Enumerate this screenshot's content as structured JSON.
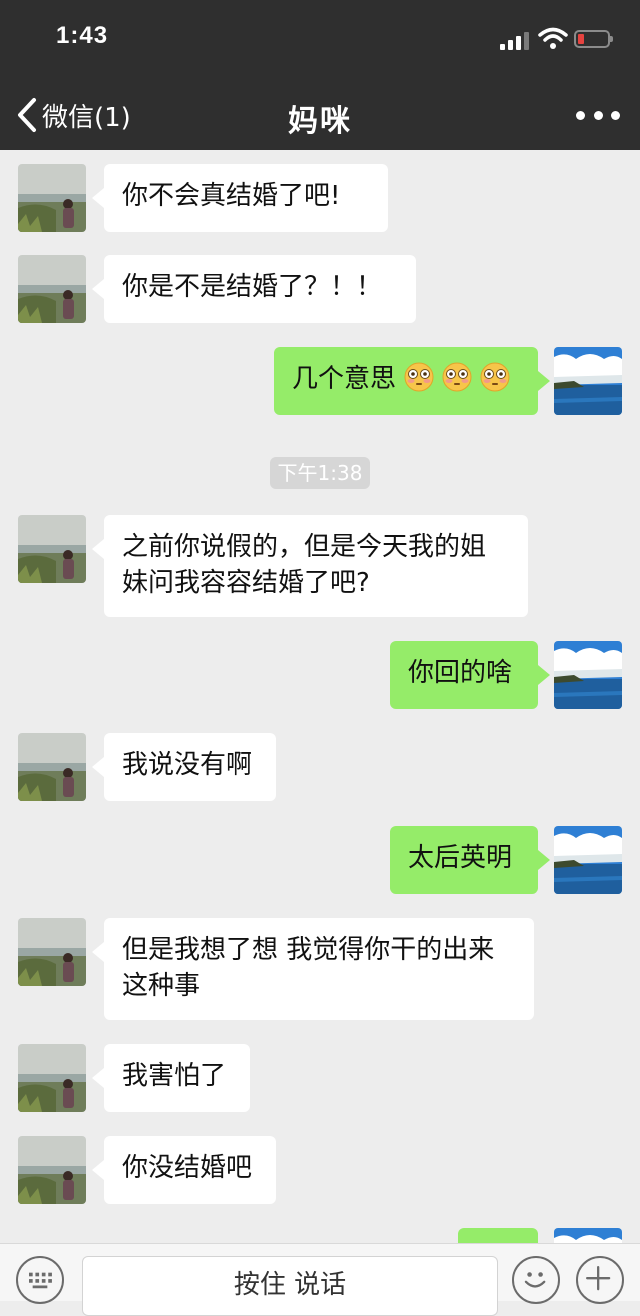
{
  "status_bar": {
    "time": "1:43"
  },
  "nav": {
    "back_label": "微信(1)",
    "title": "妈咪"
  },
  "colors": {
    "header_bg": "#2f2f2f",
    "chat_bg": "#ededed",
    "bubble_in": "#ffffff",
    "bubble_out": "#95ec69",
    "battery_low": "#e64340"
  },
  "messages": [
    {
      "from": "mom",
      "text": "你不会真结婚了吧!"
    },
    {
      "from": "mom",
      "text": "你是不是结婚了？！！"
    },
    {
      "from": "me",
      "text": "几个意思",
      "emoji": [
        "flushed-face-icon",
        "flushed-face-icon",
        "flushed-face-icon"
      ]
    },
    {
      "from": "mom",
      "text": "之前你说假的，但是今天我的姐妹问我容容结婚了吧?"
    },
    {
      "from": "me",
      "text": "你回的啥"
    },
    {
      "from": "mom",
      "text": "我说没有啊"
    },
    {
      "from": "me",
      "text": "太后英明"
    },
    {
      "from": "mom",
      "text": "但是我想了想 我觉得你干的出来这种事"
    },
    {
      "from": "mom",
      "text": "我害怕了"
    },
    {
      "from": "mom",
      "text": "你没结婚吧"
    }
  ],
  "timestamp": "下午1:38",
  "input_bar": {
    "hold_to_talk": "按住 说话",
    "icons": [
      "keyboard-icon",
      "emoji-icon",
      "plus-icon"
    ]
  }
}
